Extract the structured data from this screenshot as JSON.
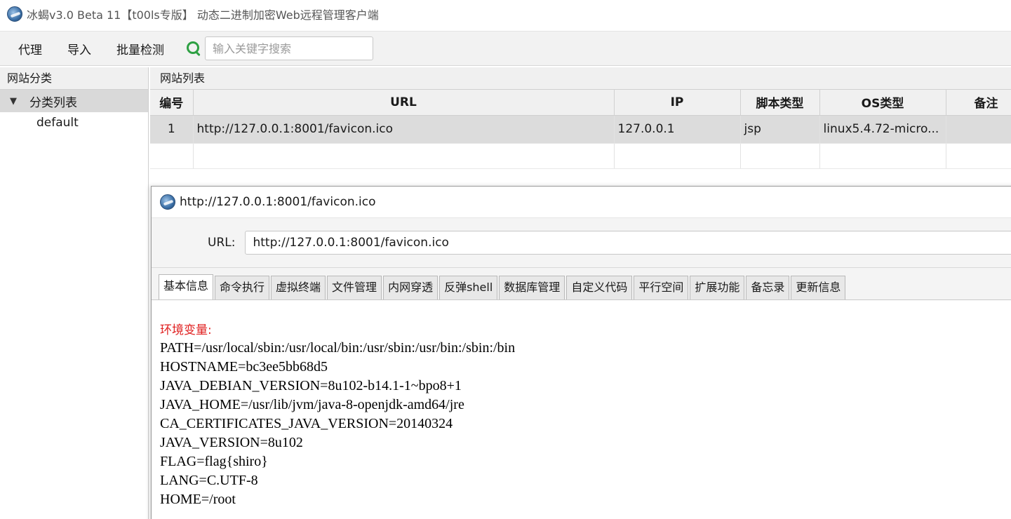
{
  "app": {
    "title": "冰蝎v3.0 Beta 11【t00ls专版】 动态二进制加密Web远程管理客户端",
    "icon": "ice-scorpion-icon"
  },
  "toolbar": {
    "menu": [
      "代理",
      "导入",
      "批量检测"
    ],
    "search_placeholder": "输入关键字搜索"
  },
  "sidebar": {
    "header": "网站分类",
    "root_label": "分类列表",
    "children": [
      "default"
    ]
  },
  "site_list": {
    "header": "网站列表",
    "columns": [
      "编号",
      "URL",
      "IP",
      "脚本类型",
      "OS类型",
      "备注"
    ],
    "rows": [
      {
        "id": "1",
        "url": "http://127.0.0.1:8001/favicon.ico",
        "ip": "127.0.0.1",
        "script": "jsp",
        "os": "linux5.4.72-micro...",
        "note": ""
      }
    ]
  },
  "shell_window": {
    "title": "http://127.0.0.1:8001/favicon.ico",
    "url_label": "URL:",
    "url_value": "http://127.0.0.1:8001/favicon.ico",
    "tabs": [
      "基本信息",
      "命令执行",
      "虚拟终端",
      "文件管理",
      "内网穿透",
      "反弹shell",
      "数据库管理",
      "自定义代码",
      "平行空间",
      "扩展功能",
      "备忘录",
      "更新信息"
    ],
    "active_tab": 0,
    "env_heading": "环境变量:",
    "env_lines": [
      "PATH=/usr/local/sbin:/usr/local/bin:/usr/sbin:/usr/bin:/sbin:/bin",
      "HOSTNAME=bc3ee5bb68d5",
      "JAVA_DEBIAN_VERSION=8u102-b14.1-1~bpo8+1",
      "JAVA_HOME=/usr/lib/jvm/java-8-openjdk-amd64/jre",
      "CA_CERTIFICATES_JAVA_VERSION=20140324",
      "JAVA_VERSION=8u102",
      "FLAG=flag{shiro}",
      "LANG=C.UTF-8",
      "HOME=/root"
    ]
  },
  "colors": {
    "accent_search": "#2ea043",
    "env_heading": "#e02020",
    "selected_row": "#dcdcdc"
  }
}
